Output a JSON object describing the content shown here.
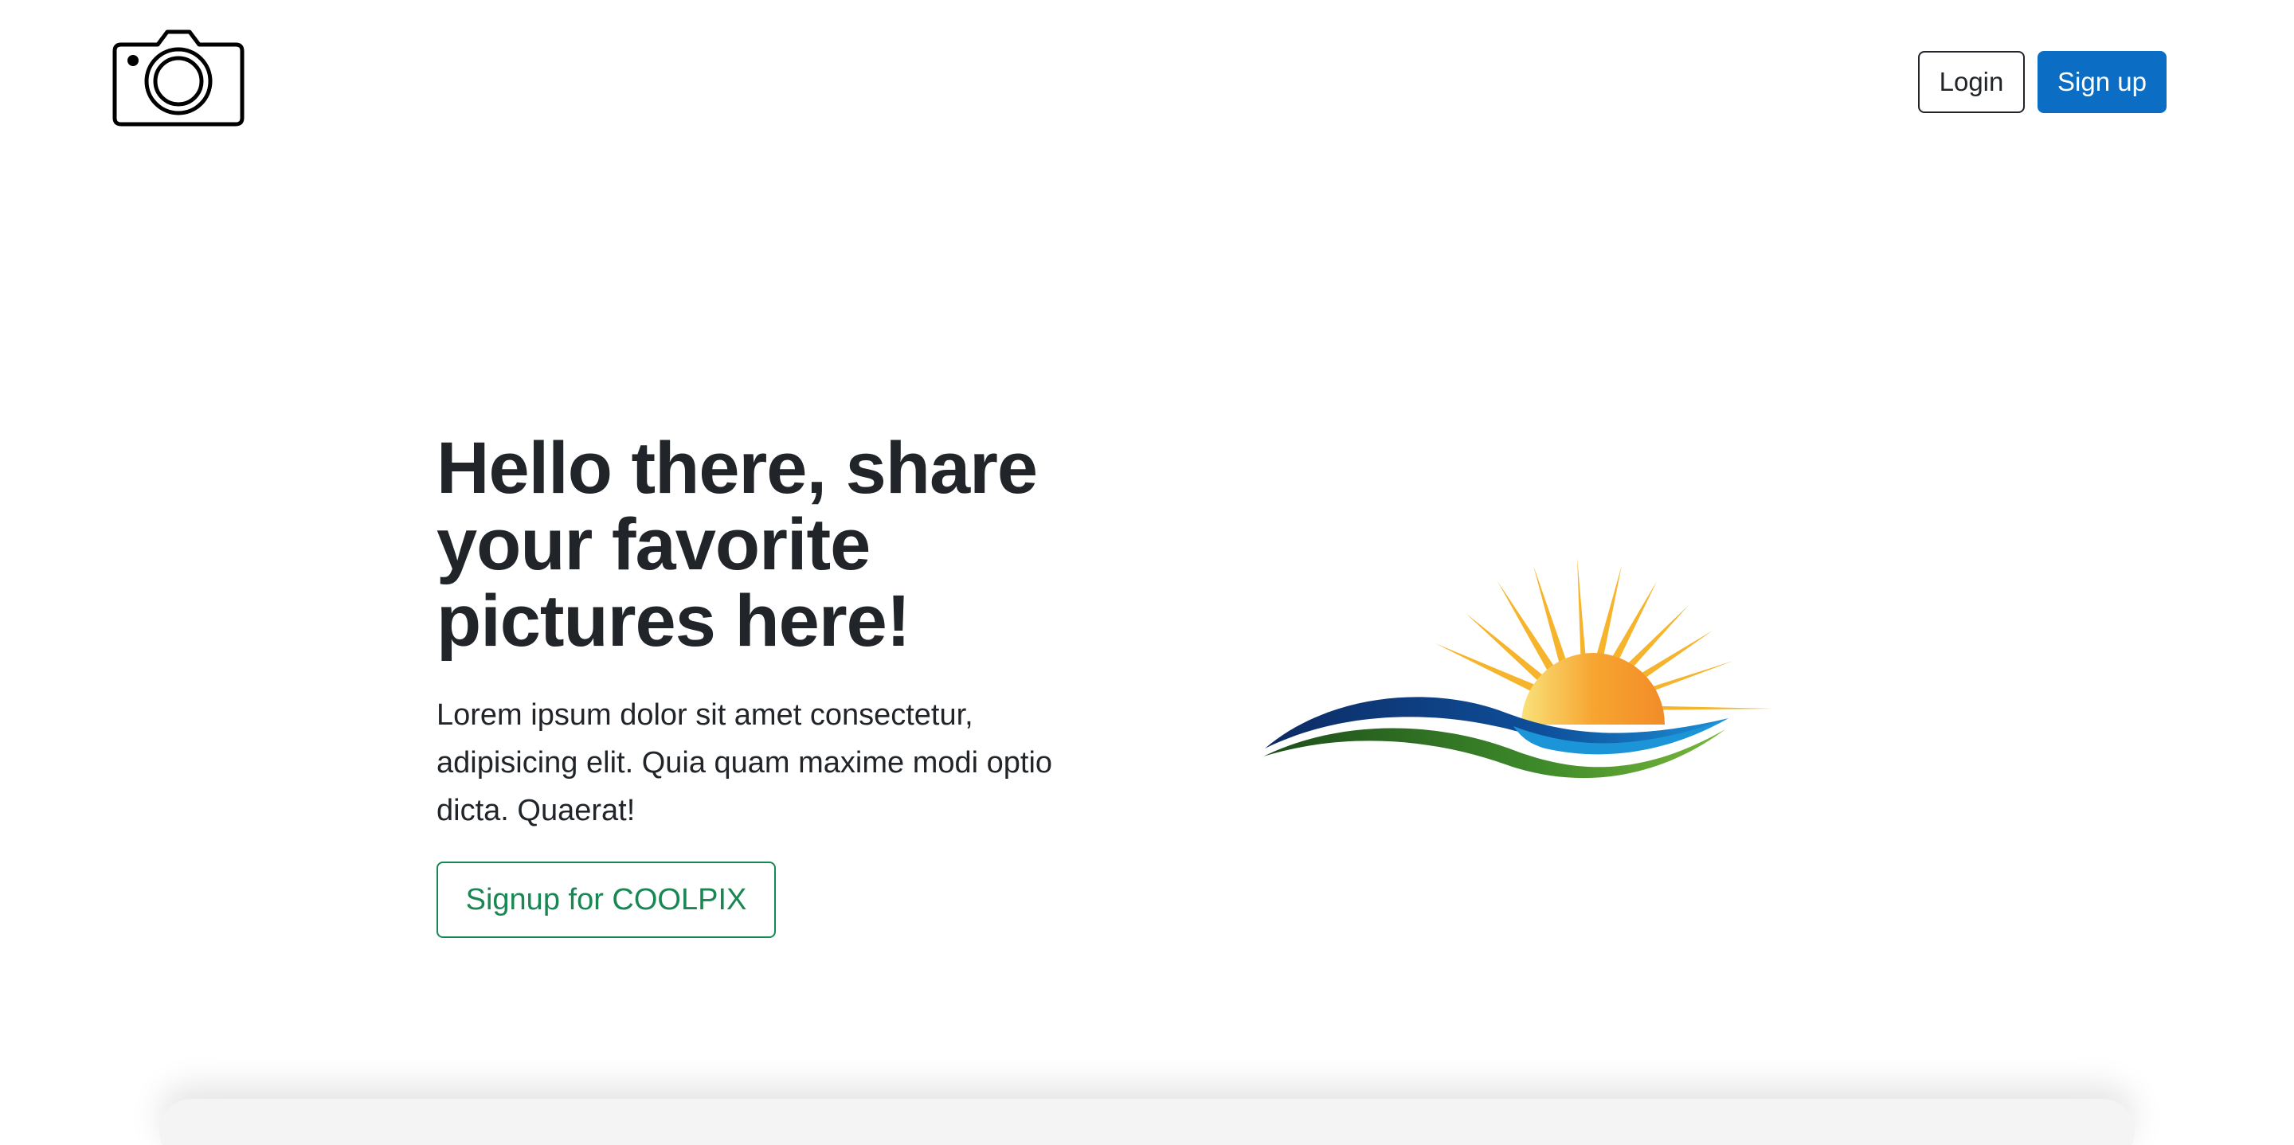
{
  "header": {
    "logo_icon": "camera-icon",
    "login_label": "Login",
    "signup_label": "Sign up"
  },
  "hero": {
    "title": "Hello there, share your favorite pictures here!",
    "lead": "Lorem ipsum dolor sit amet consectetur, adipisicing elit. Quia quam maxime modi optio dicta. Quaerat!",
    "cta_label": "Signup for COOLPIX",
    "image_icon": "sunrise-logo-icon"
  },
  "colors": {
    "primary": "#0b6ec4",
    "success": "#198754",
    "text": "#212529"
  }
}
